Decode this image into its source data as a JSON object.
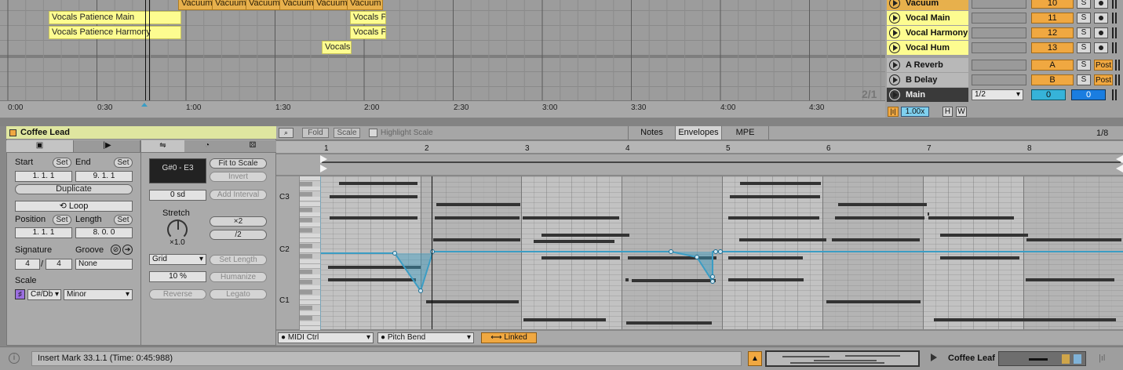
{
  "arrangement": {
    "clips": [
      {
        "name": "Vacuum",
        "kind": "vac"
      },
      {
        "name": "Vacuum",
        "kind": "vac"
      },
      {
        "name": "Vacuum",
        "kind": "vac"
      },
      {
        "name": "Vacuum",
        "kind": "vac"
      },
      {
        "name": "Vacuum",
        "kind": "vac"
      },
      {
        "name": "Vacuum",
        "kind": "vac"
      },
      {
        "name": "Vocals Patience Main",
        "kind": "voc"
      },
      {
        "name": "Vocals Pa",
        "kind": "voc"
      },
      {
        "name": "Vocals Patience Harmony",
        "kind": "voc"
      },
      {
        "name": "Vocals Pa",
        "kind": "voc"
      },
      {
        "name": "Vocals",
        "kind": "voc"
      }
    ],
    "page_indicator": "2/1",
    "time_ticks": [
      "0:00",
      "0:30",
      "1:00",
      "1:30",
      "2:00",
      "2:30",
      "3:00",
      "3:30",
      "4:00",
      "4:30"
    ]
  },
  "mixer": {
    "tracks": [
      {
        "name": "Vacuum",
        "num": "10",
        "solo": "S"
      },
      {
        "name": "Vocal Main",
        "num": "11",
        "solo": "S"
      },
      {
        "name": "Vocal Harmony",
        "num": "12",
        "solo": "S"
      },
      {
        "name": "Vocal Hum",
        "num": "13",
        "solo": "S"
      }
    ],
    "returns": [
      {
        "name": "A Reverb",
        "num": "A",
        "solo": "S",
        "post": "Post"
      },
      {
        "name": "B Delay",
        "num": "B",
        "solo": "S",
        "post": "Post"
      }
    ],
    "main": {
      "name": "Main",
      "tempo_select": "1/2",
      "left_val": "0",
      "right_val": "0"
    },
    "zoom": "1.00x",
    "h_btn": "H",
    "w_btn": "W"
  },
  "clip_view": {
    "title": "Coffee Lead",
    "start_label": "Start",
    "set": "Set",
    "end_label": "End",
    "start": "1.   1.   1",
    "end": "9.   1.   1",
    "duplicate": "Duplicate",
    "loop": "Loop",
    "position_label": "Position",
    "length_label": "Length",
    "position": "1.   1.   1",
    "length": "8.   0.   0",
    "signature_label": "Signature",
    "groove_label": "Groove",
    "sig_num": "4",
    "sig_den": "4",
    "groove": "None",
    "scale_label": "Scale",
    "scale_root": "C#/Db",
    "scale_mode": "Minor"
  },
  "note_tools": {
    "range": "G#0 - E3",
    "fit_to_scale": "Fit to Scale",
    "invert": "Invert",
    "sd": "0 sd",
    "add_interval": "Add Interval",
    "stretch_label": "Stretch",
    "stretch_val": "×1.0",
    "x2": "×2",
    "div2": "/2",
    "grid": "Grid",
    "set_length": "Set Length",
    "pct": "10 %",
    "humanize": "Humanize",
    "reverse": "Reverse",
    "legato": "Legato"
  },
  "editor": {
    "fold": "Fold",
    "scale": "Scale",
    "highlight_scale": "Highlight Scale",
    "tabs": [
      "Notes",
      "Envelopes",
      "MPE"
    ],
    "grid_val": "1/8",
    "bars": [
      "1",
      "2",
      "3",
      "4",
      "5",
      "6",
      "7",
      "8"
    ],
    "pitch_labels": [
      "C3",
      "C2",
      "C1"
    ],
    "env_source": "MIDI Ctrl",
    "env_control": "Pitch Bend",
    "linked": "Linked"
  },
  "status": {
    "message": "Insert Mark 33.1.1 (Time: 0:45:988)",
    "device": "Coffee Leaf"
  },
  "colors": {
    "clip_yellow": "#fdfc90",
    "vacuum_orange": "#e7b04c",
    "track_orange": "#f0a841",
    "envelope_blue": "#3b9dc4",
    "title_green": "#dfe6a0"
  }
}
